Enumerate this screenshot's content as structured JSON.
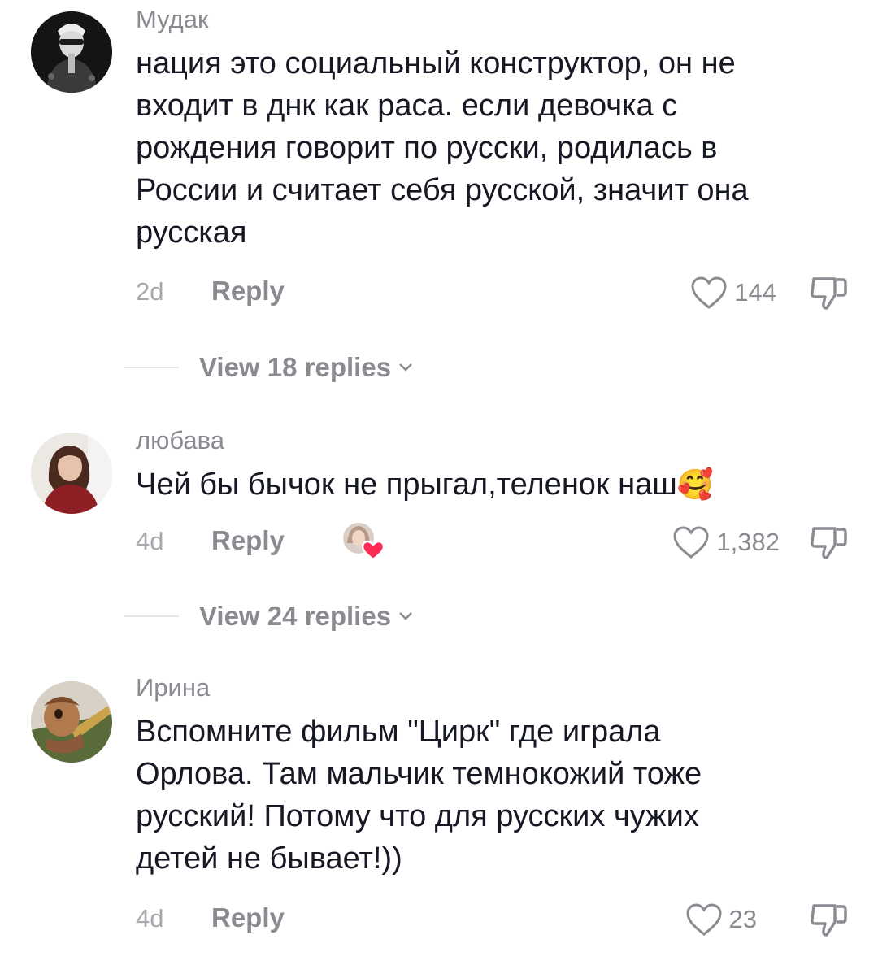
{
  "comments": [
    {
      "username": "Мудак",
      "lines": [
        "нация это социальный конструктор, он не",
        "входит в днк как раса. если девочка с",
        "рождения говорит по русски, родилась в",
        "России и считает себя русской, значит она",
        "русская"
      ],
      "time": "2d",
      "reply_label": "Reply",
      "likes": "144",
      "view_replies": "View 18 replies",
      "avatar_icon": "avatar-dark-figure"
    },
    {
      "username": "любава",
      "lines": [
        "Чей бы бычок не прыгал,теленок наш"
      ],
      "emoji": "🥰",
      "time": "4d",
      "reply_label": "Reply",
      "likes": "1,382",
      "view_replies": "View 24 replies",
      "creator_liked": true,
      "avatar_icon": "avatar-woman-red-sweater"
    },
    {
      "username": "Ирина",
      "lines": [
        "Вспомните фильм \"Цирк\" где играла",
        "Орлова. Там мальчик темнокожий тоже",
        "русский! Потому что для русских чужих",
        "детей не бывает!))"
      ],
      "time": "4d",
      "reply_label": "Reply",
      "likes": "23",
      "avatar_icon": "avatar-painting"
    }
  ],
  "icons": {
    "like": "heart-outline-icon",
    "dislike": "thumbs-down-icon",
    "expand": "chevron-down-icon",
    "creator_heart": "creator-liked-heart-icon"
  },
  "colors": {
    "text": "#161823",
    "secondary": "#8a8b91",
    "heart_red": "#fe2c55"
  }
}
